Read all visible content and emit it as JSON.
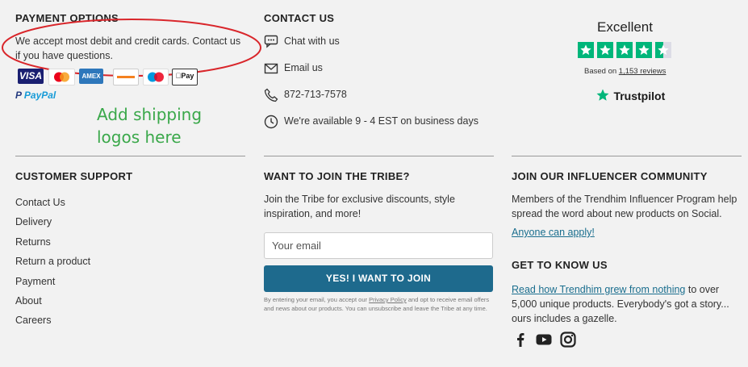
{
  "payment": {
    "heading": "PAYMENT OPTIONS",
    "description_line1": "We accept most debit and credit cards. Contact us",
    "description_line2": "if you have questions.",
    "cards": {
      "visa": "VISA",
      "amex": "AMEX",
      "applepay": "Pay"
    },
    "paypal": "PayPal"
  },
  "annotation": {
    "line1": "Add shipping",
    "line2": "logos here",
    "color": "#3aa84a",
    "circle_color": "#d9262b"
  },
  "contact": {
    "heading": "CONTACT US",
    "items": [
      {
        "icon": "chat-icon",
        "label": "Chat with us"
      },
      {
        "icon": "mail-icon",
        "label": "Email us"
      },
      {
        "icon": "phone-icon",
        "label": "872-713-7578"
      },
      {
        "icon": "clock-icon",
        "label": "We're available 9 - 4 EST on business days"
      }
    ]
  },
  "trustpilot": {
    "rating_label": "Excellent",
    "based_on_prefix": "Based on ",
    "reviews_link": "1,153 reviews",
    "brand": "Trustpilot",
    "stars": 4.5,
    "color": "#00b67a"
  },
  "customer_support": {
    "heading": "CUSTOMER SUPPORT",
    "links": [
      "Contact Us",
      "Delivery",
      "Returns",
      "Return a product",
      "Payment",
      "About",
      "Careers"
    ]
  },
  "tribe": {
    "heading": "WANT TO JOIN THE TRIBE?",
    "description_line1": "Join the Tribe for exclusive discounts, style",
    "description_line2": "inspiration, and more!",
    "email_placeholder": "Your email",
    "button_label": "YES! I WANT TO JOIN",
    "fine_print_1": "By entering your email, you accept our ",
    "privacy_link": "Privacy Policy",
    "fine_print_2": " and opt to receive email offers and news about our products. You can unsubscribe and leave the Tribe at any time.",
    "button_color": "#1e6a8d"
  },
  "influencer": {
    "heading": "JOIN OUR INFLUENCER COMMUNITY",
    "description_line1": "Members of the Trendhim Influencer Program help",
    "description_line2": "spread the word about new products on Social.",
    "link": "Anyone can apply!"
  },
  "get_to_know": {
    "heading": "GET TO KNOW US",
    "link": "Read how Trendhim grew from nothing",
    "text_after_link": " to over",
    "line2": "5,000 unique products. Everybody's got a story...",
    "line3": "ours includes a gazelle."
  },
  "social": [
    "facebook-icon",
    "youtube-icon",
    "instagram-icon"
  ]
}
